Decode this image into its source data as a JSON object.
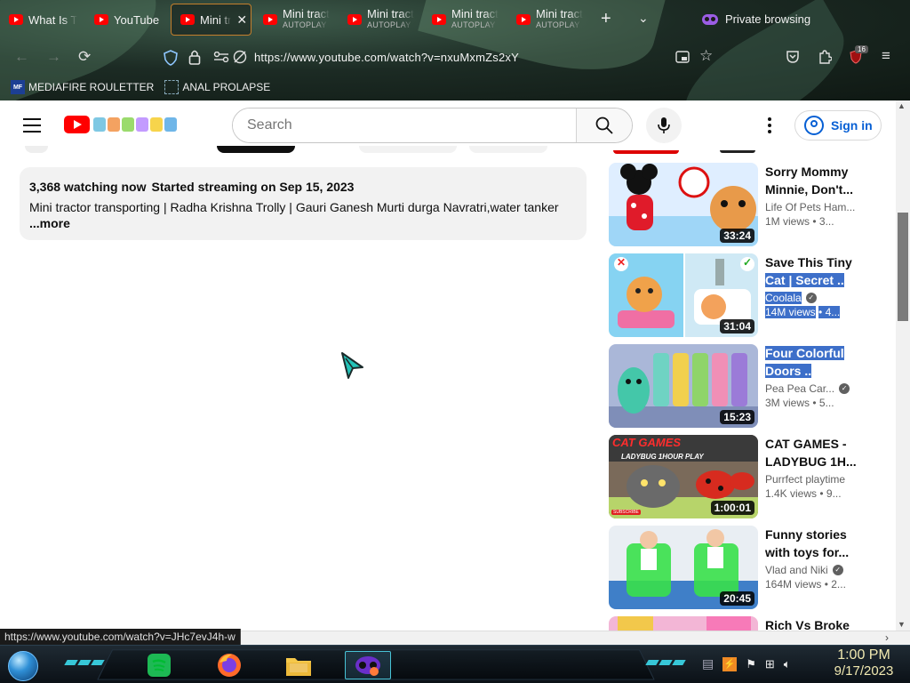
{
  "browser": {
    "tabs": [
      {
        "label": "What Is T",
        "sub": "",
        "active": false
      },
      {
        "label": "YouTube",
        "sub": "",
        "active": false
      },
      {
        "label": "Mini tr",
        "sub": "",
        "active": true
      },
      {
        "label": "Mini tract",
        "sub": "AUTOPLAY",
        "active": false
      },
      {
        "label": "Mini tract",
        "sub": "AUTOPLAY",
        "active": false
      },
      {
        "label": "Mini tract",
        "sub": "AUTOPLAY",
        "active": false
      },
      {
        "label": "Mini tract",
        "sub": "AUTOPLAY",
        "active": false
      }
    ],
    "private_label": "Private browsing",
    "url": "https://www.youtube.com/watch?v=nxuMxmZs2xY",
    "extension_badge": "16",
    "bookmarks": [
      {
        "label": "MEDIAFIRE ROULETTER",
        "icon_text": "MF"
      },
      {
        "label": "ANAL PROLAPSE",
        "icon_text": ""
      }
    ]
  },
  "youtube": {
    "search_placeholder": "Search",
    "signin_label": "Sign in"
  },
  "description": {
    "watching": "3,368 watching now",
    "started": "Started streaming on Sep 15, 2023",
    "text": "Mini tractor transporting | Radha Krishna Trolly | Gauri Ganesh Murti durga Navratri,water tanker",
    "more": "...more"
  },
  "recommendations": [
    {
      "title_a": "Sorry Mommy",
      "title_b": "Minnie, Don't...",
      "channel": "Life Of Pets Ham...",
      "verified": false,
      "views": "1M views",
      "age": "• 3...",
      "duration": "33:24"
    },
    {
      "title_a": "Save This Tiny",
      "title_b": "Cat | Secret ..",
      "channel": "Coolala",
      "verified": true,
      "views": "14M views",
      "age": "• 4...",
      "duration": "31:04"
    },
    {
      "title_a": "Four Colorful",
      "title_b": "Doors ..",
      "channel": "Pea Pea Car...",
      "verified": true,
      "views": "3M views",
      "age": "• 5...",
      "duration": "15:23"
    },
    {
      "title_a": "CAT GAMES -",
      "title_b": "LADYBUG 1H...",
      "channel": "Purrfect playtime",
      "verified": false,
      "views": "1.4K views",
      "age": "• 9...",
      "duration": "1:00:01",
      "thumb_title": "CAT GAMES",
      "thumb_sub": "LADYBUG 1HOUR PLAY",
      "thumb_badge": "SUBSCRIBE"
    },
    {
      "title_a": "Funny stories",
      "title_b": "with toys for...",
      "channel": "Vlad and Niki",
      "verified": true,
      "views": "164M views",
      "age": "• 2...",
      "duration": "20:45"
    },
    {
      "title_a": "Rich Vs Broke",
      "title_b": "",
      "channel": "",
      "verified": false,
      "views": "",
      "age": "",
      "duration": ""
    }
  ],
  "status_bar_url": "https://www.youtube.com/watch?v=JHc7evJ4h-w",
  "taskbar": {
    "time": "1:00 PM",
    "date": "9/17/2023"
  },
  "colors": {
    "youtube_red": "#ff0000",
    "link_blue": "#065fd4",
    "selection_blue": "#3d6fc9",
    "private_purple": "#9b5de5"
  }
}
